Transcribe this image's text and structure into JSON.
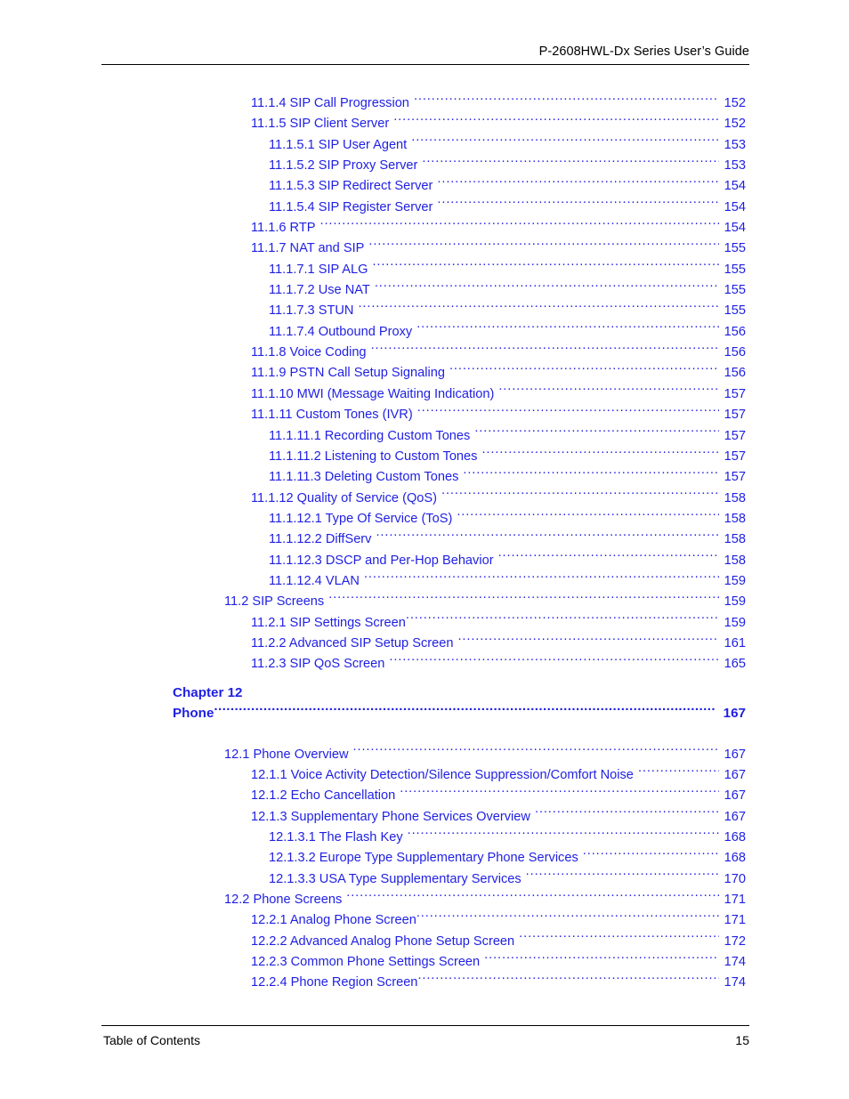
{
  "document": {
    "running_head": "P-2608HWL-Dx Series User’s Guide",
    "footer_left": "Table of Contents",
    "footer_page_number": "15",
    "link_color": "#1f1fe3",
    "rule_color": "#000000"
  },
  "toc": {
    "entries": [
      {
        "label": "11.1.4 SIP Call Progression ",
        "page": "152",
        "level": 3
      },
      {
        "label": "11.1.5 SIP Client Server  ",
        "page": "152",
        "level": 3
      },
      {
        "label": "11.1.5.1 SIP User Agent ",
        "page": "153",
        "level": 4
      },
      {
        "label": "11.1.5.2 SIP Proxy Server  ",
        "page": "153",
        "level": 4
      },
      {
        "label": "11.1.5.3 SIP Redirect Server  ",
        "page": "154",
        "level": 4
      },
      {
        "label": "11.1.5.4 SIP Register Server ",
        "page": "154",
        "level": 4
      },
      {
        "label": "11.1.6 RTP ",
        "page": "154",
        "level": 3
      },
      {
        "label": "11.1.7 NAT and SIP  ",
        "page": "155",
        "level": 3
      },
      {
        "label": "11.1.7.1 SIP ALG ",
        "page": "155",
        "level": 4
      },
      {
        "label": "11.1.7.2 Use NAT  ",
        "page": "155",
        "level": 4
      },
      {
        "label": "11.1.7.3 STUN  ",
        "page": "155",
        "level": 4
      },
      {
        "label": "11.1.7.4 Outbound Proxy ",
        "page": "156",
        "level": 4
      },
      {
        "label": "11.1.8 Voice Coding ",
        "page": "156",
        "level": 3
      },
      {
        "label": "11.1.9 PSTN Call Setup Signaling  ",
        "page": "156",
        "level": 3
      },
      {
        "label": "11.1.10 MWI (Message Waiting Indication)  ",
        "page": "157",
        "level": 3
      },
      {
        "label": "11.1.11 Custom Tones (IVR) ",
        "page": "157",
        "level": 3
      },
      {
        "label": "11.1.11.1 Recording Custom Tones  ",
        "page": "157",
        "level": 4
      },
      {
        "label": "11.1.11.2 Listening to Custom Tones  ",
        "page": "157",
        "level": 4
      },
      {
        "label": "11.1.11.3 Deleting Custom Tones ",
        "page": "157",
        "level": 4
      },
      {
        "label": "11.1.12 Quality of Service (QoS)  ",
        "page": "158",
        "level": 3
      },
      {
        "label": "11.1.12.1 Type Of Service (ToS)  ",
        "page": "158",
        "level": 4
      },
      {
        "label": "11.1.12.2 DiffServ ",
        "page": "158",
        "level": 4
      },
      {
        "label": "11.1.12.3 DSCP and Per-Hop Behavior  ",
        "page": "158",
        "level": 4
      },
      {
        "label": "11.1.12.4 VLAN  ",
        "page": "159",
        "level": 4
      },
      {
        "label": "11.2 SIP Screens  ",
        "page": "159",
        "level": 2
      },
      {
        "label": "11.2.1 SIP Settings Screen",
        "page": "159",
        "level": 3
      },
      {
        "label": "11.2.2 Advanced SIP Setup Screen ",
        "page": "161",
        "level": 3
      },
      {
        "label": "11.2.3 SIP QoS Screen ",
        "page": "165",
        "level": 3
      }
    ],
    "chapter": {
      "number_label": "Chapter 12",
      "title": "Phone ",
      "page": "167"
    },
    "entries_after_chapter": [
      {
        "label": "12.1 Phone Overview  ",
        "page": "167",
        "level": 2
      },
      {
        "label": "12.1.1 Voice Activity Detection/Silence Suppression/Comfort Noise ",
        "page": "167",
        "level": 3
      },
      {
        "label": "12.1.2 Echo Cancellation  ",
        "page": "167",
        "level": 3
      },
      {
        "label": "12.1.3 Supplementary Phone Services Overview  ",
        "page": "167",
        "level": 3
      },
      {
        "label": "12.1.3.1 The Flash Key  ",
        "page": "168",
        "level": 4
      },
      {
        "label": "12.1.3.2 Europe Type Supplementary Phone Services ",
        "page": "168",
        "level": 4
      },
      {
        "label": "12.1.3.3 USA Type Supplementary Services  ",
        "page": "170",
        "level": 4
      },
      {
        "label": "12.2 Phone Screens ",
        "page": "171",
        "level": 2
      },
      {
        "label": "12.2.1 Analog Phone Screen",
        "page": "171",
        "level": 3
      },
      {
        "label": "12.2.2 Advanced Analog Phone Setup Screen ",
        "page": "172",
        "level": 3
      },
      {
        "label": "12.2.3 Common Phone Settings Screen ",
        "page": "174",
        "level": 3
      },
      {
        "label": "12.2.4 Phone Region Screen",
        "page": "174",
        "level": 3
      }
    ]
  }
}
